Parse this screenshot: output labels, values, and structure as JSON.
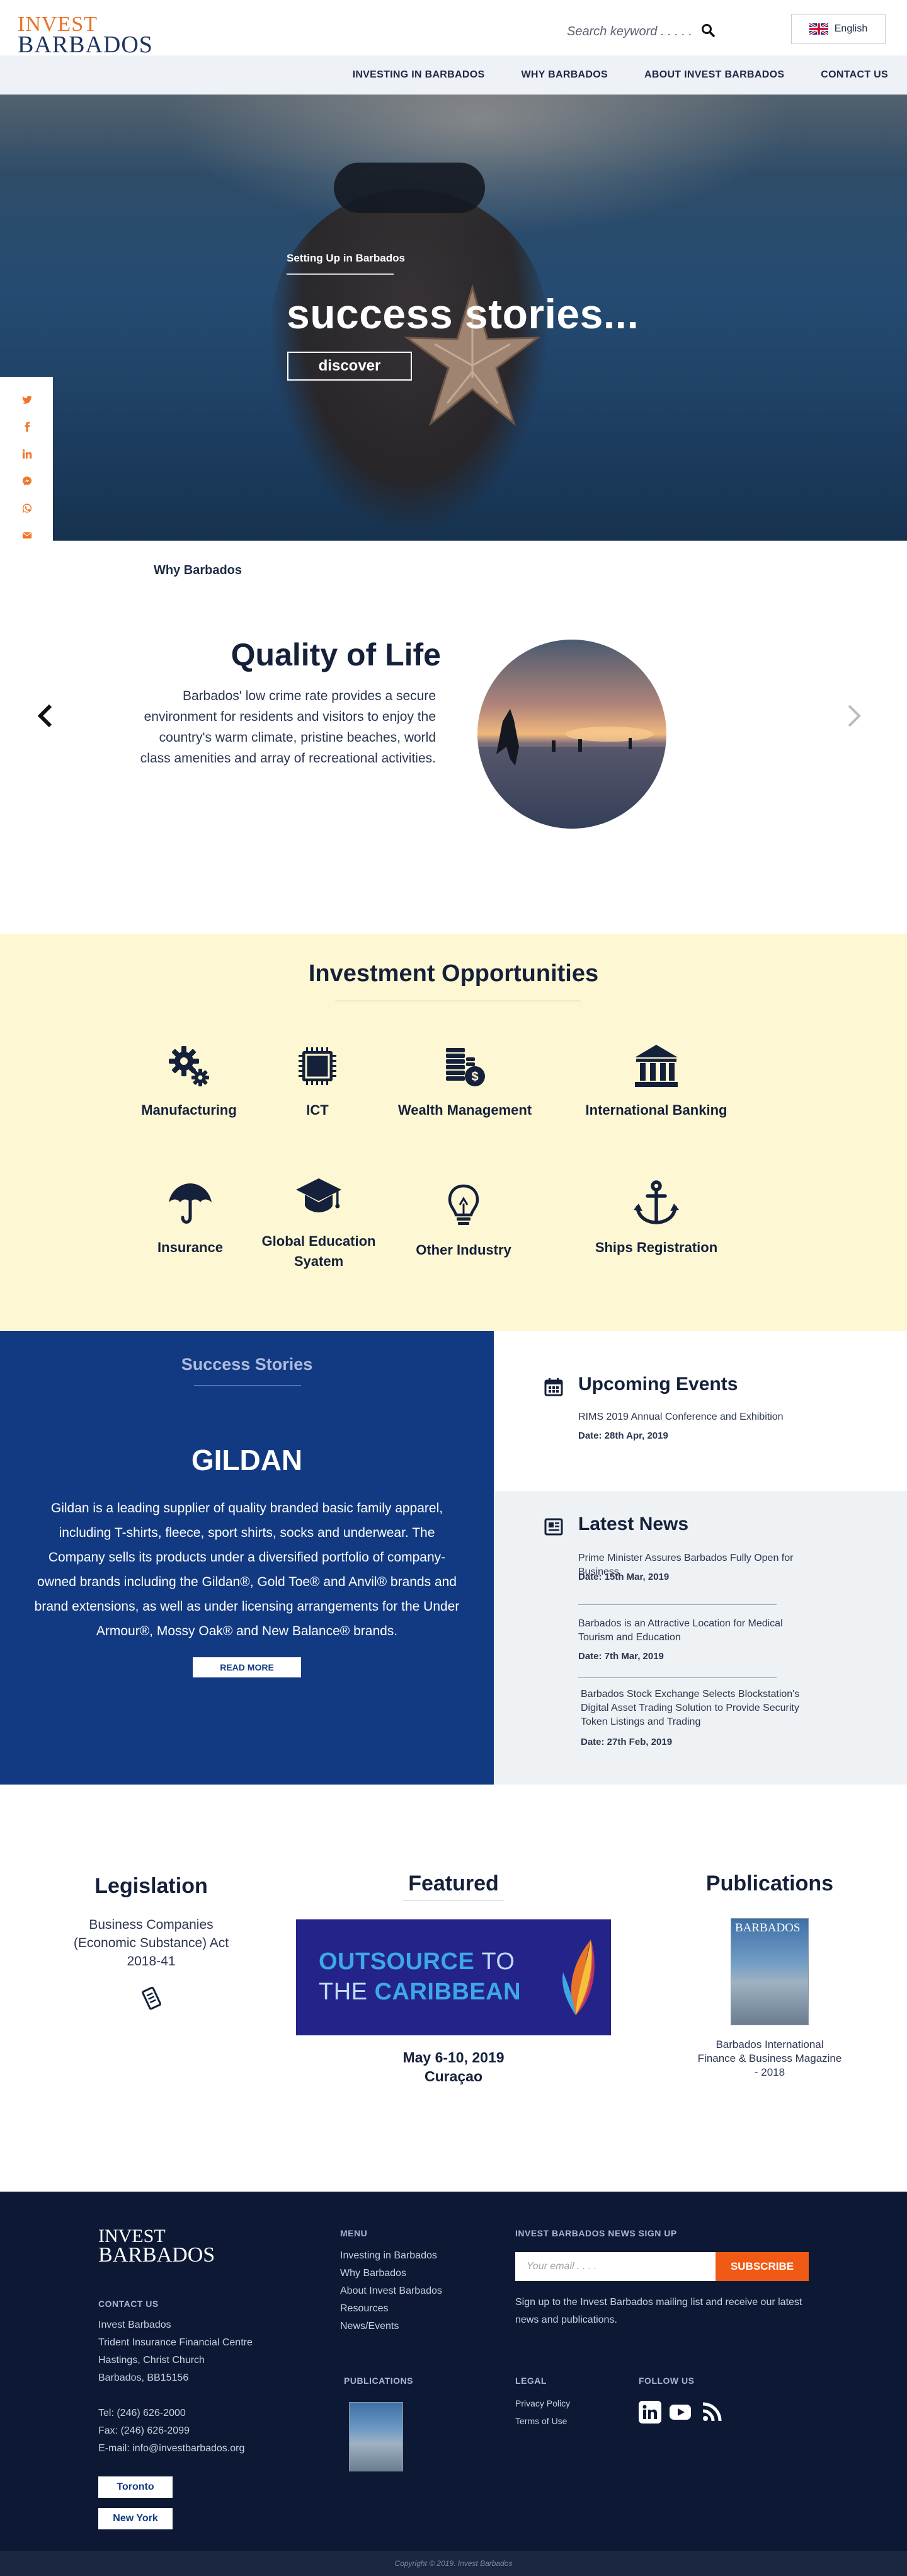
{
  "brand": {
    "line1": "INVEST",
    "line2": "BARBADOS",
    "colors": {
      "accent": "#e8742a",
      "navy": "#1f3463",
      "primary": "#123a82",
      "highlight": "#fdf8d3",
      "footer": "#0d1934",
      "cta": "#f05a14"
    }
  },
  "header": {
    "search_placeholder": "Search keyword . . . . .",
    "search_icon": "search-icon",
    "language": "English",
    "flag_icon": "uk-flag-icon"
  },
  "nav": {
    "items": [
      "INVESTING IN BARBADOS",
      "WHY BARBADOS",
      "ABOUT INVEST BARBADOS",
      "CONTACT US"
    ]
  },
  "hero": {
    "kicker": "Setting Up in Barbados",
    "title": "success stories...",
    "button": "discover"
  },
  "social_share": [
    "twitter-icon",
    "facebook-icon",
    "linkedin-icon",
    "messenger-icon",
    "whatsapp-icon",
    "email-icon"
  ],
  "why": {
    "label": "Why Barbados",
    "title": "Quality of Life",
    "text": "Barbados' low crime rate provides a secure environment for residents and visitors to enjoy the country's warm climate, pristine beaches, world class amenities and array of recreational activities."
  },
  "investment": {
    "title": "Investment Opportunities",
    "items": [
      {
        "label": "Manufacturing",
        "icon": "gears-icon"
      },
      {
        "label": "ICT",
        "icon": "chip-icon"
      },
      {
        "label": "Wealth Management",
        "icon": "coins-icon"
      },
      {
        "label": "International Banking",
        "icon": "bank-icon"
      },
      {
        "label": "Insurance",
        "icon": "umbrella-icon"
      },
      {
        "label": "Global Education Syatem",
        "icon": "graduation-cap-icon"
      },
      {
        "label": "Other Industry",
        "icon": "lightbulb-icon"
      },
      {
        "label": "Ships Registration",
        "icon": "anchor-icon"
      }
    ]
  },
  "success": {
    "label": "Success Stories",
    "name": "GILDAN",
    "text": "Gildan is a leading supplier of quality branded basic family apparel, including T-shirts, fleece, sport shirts, socks and underwear. The Company sells its products under a diversified portfolio of company-owned brands  including the Gildan®, Gold Toe® and Anvil® brands and brand extensions, as well as under licensing arrangements for the Under Armour®, Mossy Oak® and New Balance® brands.",
    "button": "READ MORE"
  },
  "events": {
    "title": "Upcoming Events",
    "items": [
      {
        "title": "RIMS 2019 Annual Conference and Exhibition",
        "date": "Date: 28th Apr, 2019"
      }
    ]
  },
  "news": {
    "title": "Latest News",
    "items": [
      {
        "title": "Prime Minister Assures Barbados Fully Open for Business",
        "date": "Date: 15th Mar, 2019"
      },
      {
        "title": "Barbados is an Attractive Location for Medical Tourism and Education",
        "date": "Date: 7th Mar, 2019"
      },
      {
        "title": "Barbados Stock Exchange Selects Blockstation's Digital Asset Trading Solution to Provide Security Token Listings and Trading",
        "date": "Date: 27th Feb, 2019"
      }
    ]
  },
  "legislation": {
    "title": "Legislation",
    "text": "Business Companies (Economic Substance) Act 2018-41"
  },
  "featured": {
    "title": "Featured",
    "banner_line1a": "OUTSOURCE",
    "banner_line1b": "TO",
    "banner_line2a": "THE",
    "banner_line2b": "CARIBBEAN",
    "date": "May 6-10, 2019",
    "place": "Curaçao"
  },
  "publications": {
    "title": "Publications",
    "cover_title": "BARBADOS",
    "text": "Barbados International Finance & Business Magazine -  2018"
  },
  "footer": {
    "menu_title": "MENU",
    "menu": [
      "Investing in Barbados",
      "Why Barbados",
      "About Invest Barbados",
      "Resources",
      "News/Events"
    ],
    "signup_title": "INVEST BARBADOS NEWS SIGN UP",
    "email_placeholder": "Your email . . . .",
    "subscribe": "SUBSCRIBE",
    "signup_text": "Sign up to the Invest Barbados mailing list and receive our latest  news and publications.",
    "contact_title": "CONTACT US",
    "address": [
      "Invest Barbados",
      "Trident Insurance Financial Centre",
      "Hastings, Christ Church",
      "Barbados, BB15156"
    ],
    "tel": "Tel: (246) 626-2000",
    "fax": "Fax: (246) 626-2099",
    "email": "E-mail: info@investbarbados.org",
    "offices": [
      "Toronto",
      "New York"
    ],
    "publications_title": "PUBLICATIONS",
    "legal_title": "LEGAL",
    "legal": [
      "Privacy Policy",
      "Terms of Use"
    ],
    "follow_title": "FOLLOW US",
    "copyright": "Copyright © 2019. Invest Barbados"
  }
}
